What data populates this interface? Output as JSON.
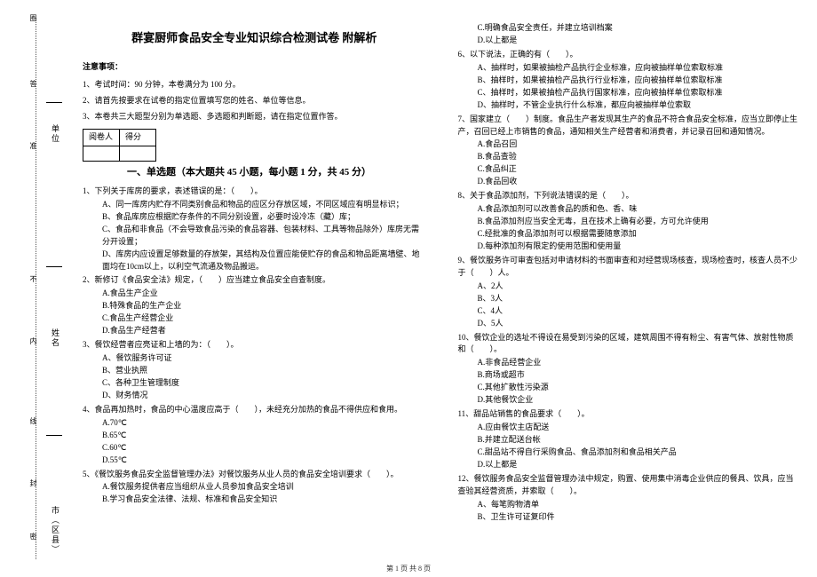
{
  "binding": {
    "t1": "圈",
    "t2": "答",
    "t3": "准",
    "t4": "不",
    "t5": "内",
    "t6": "线",
    "t7": "封",
    "t8": "密"
  },
  "side": {
    "city": "市（区县）",
    "name": "姓名",
    "unit": "单位"
  },
  "title": "群宴厨师食品安全专业知识综合检测试卷 附解析",
  "notice_heading": "注意事项：",
  "notice1": "1、考试时间：90 分钟，本卷满分为 100 分。",
  "notice2": "2、请首先按要求在试卷的指定位置填写您的姓名、单位等信息。",
  "notice3": "3、本卷共三大题型分别为单选题、多选题和判断题，请在指定位置作答。",
  "tbl": {
    "h1": "阅卷人",
    "h2": "得分"
  },
  "section1": "一、单选题（本大题共 45 小题，每小题 1 分，共 45 分）",
  "q1": "1、下列关于库房的要求，表述错误的是：（　　）。",
  "q1a": "A、同一库房内贮存不同类别食品和物品的应区分存放区域，不同区域应有明显标识；",
  "q1b": "B、食品库房应根据贮存条件的不同分别设置，必要时设冷冻（藏）库；",
  "q1c": "C、食品和非食品（不会导致食品污染的食品容器、包装材料、工具等物品除外）库房无需分开设置；",
  "q1d": "D、库房内应设置足够数量的存放架，其结构及位置应能使贮存的食品和物品距离墙壁、地面均在10cm以上，以利空气流通及物品搬运。",
  "q2": "2、新修订《食品安全法》规定，（　　）应当建立食品安全自查制度。",
  "q2a": "A.食品生产企业",
  "q2b": "B.特殊食品的生产企业",
  "q2c": "C.食品生产经营企业",
  "q2d": "D.食品生产经营者",
  "q3": "3、餐饮经营者应亮证和上墙的为：（　　）。",
  "q3a": "A、餐饮服务许可证",
  "q3b": "B、营业执照",
  "q3c": "C、各种卫生管理制度",
  "q3d": "D、财务情况",
  "q4": "4、食品再加热时，食品的中心温度应高于（　　），未经充分加热的食品不得供应和食用。",
  "q4a": "A.70℃",
  "q4b": "B.65℃",
  "q4c": "C.60℃",
  "q4d": "D.55℃",
  "q5": "5、《餐饮服务食品安全监督管理办法》对餐饮服务从业人员的食品安全培训要求（　　）。",
  "q5a": "A.餐饮服务提供者应当组织从业人员参加食品安全培训",
  "q5b": "B.学习食品安全法律、法规、标准和食品安全知识",
  "q5c": "C.明确食品安全责任，并建立培训档案",
  "q5d": "D.以上都是",
  "q6": "6、以下说法，正确的有（　　）。",
  "q6a": "A、抽样时，如果被抽检产品执行企业标准，应向被抽样单位索取标准",
  "q6b": "B、抽样时，如果被抽检产品执行行业标准，应向被抽样单位索取标准",
  "q6c": "C、抽样时，如果被抽检产品执行国家标准，应向被抽样单位索取标准",
  "q6d": "D、抽样时，不管企业执行什么标准，都应向被抽样单位索取",
  "q7": "7、国家建立（　　）制度。食品生产者发现其生产的食品不符合食品安全标准，应当立即停止生产，召回已经上市销售的食品，通知相关生产经营者和消费者，并记录召回和通知情况。",
  "q7a": "A.食品召回",
  "q7b": "B.食品查验",
  "q7c": "C.食品纠正",
  "q7d": "D.食品回收",
  "q8": "8、关于食品添加剂，下列说法错误的是（　　）。",
  "q8a": "A.食品添加剂可以改善食品的质和色、香、味",
  "q8b": "B.食品添加剂应当安全无毒，且在技术上确有必要，方可允许使用",
  "q8c": "C.经批准的食品添加剂可以根据需要随意添加",
  "q8d": "D.每种添加剂有限定的使用范围和使用量",
  "q9": "9、餐饮服务许可审查包括对申请材料的书面审查和对经营现场核查，现场检查时，核查人员不少于（　　）人。",
  "q9a": "A、2人",
  "q9b": "B、3人",
  "q9c": "C、4人",
  "q9d": "D、5人",
  "q10": "10、餐饮企业的选址不得设在易受到污染的区域，建筑周围不得有粉尘、有害气体、放射性物质和（　　）。",
  "q10a": "A.非食品经营企业",
  "q10b": "B.商场或超市",
  "q10c": "C.其他扩散性污染源",
  "q10d": "D.其他餐饮企业",
  "q11": "11、甜品站销售的食品要求（　　）。",
  "q11a": "A.应由餐饮主店配送",
  "q11b": "B.并建立配送台帐",
  "q11c": "C.甜品站不得自行采购食品、食品添加剂和食品相关产品",
  "q11d": "D.以上都是",
  "q12": "12、餐饮服务食品安全监督管理办法中规定，购置、使用集中消毒企业供应的餐具、饮具，应当查验其经营资质，并索取（　　）。",
  "q12a": "A、每笔购物清单",
  "q12b": "B、卫生许可证复印件",
  "footer": "第 1 页 共 8 页"
}
